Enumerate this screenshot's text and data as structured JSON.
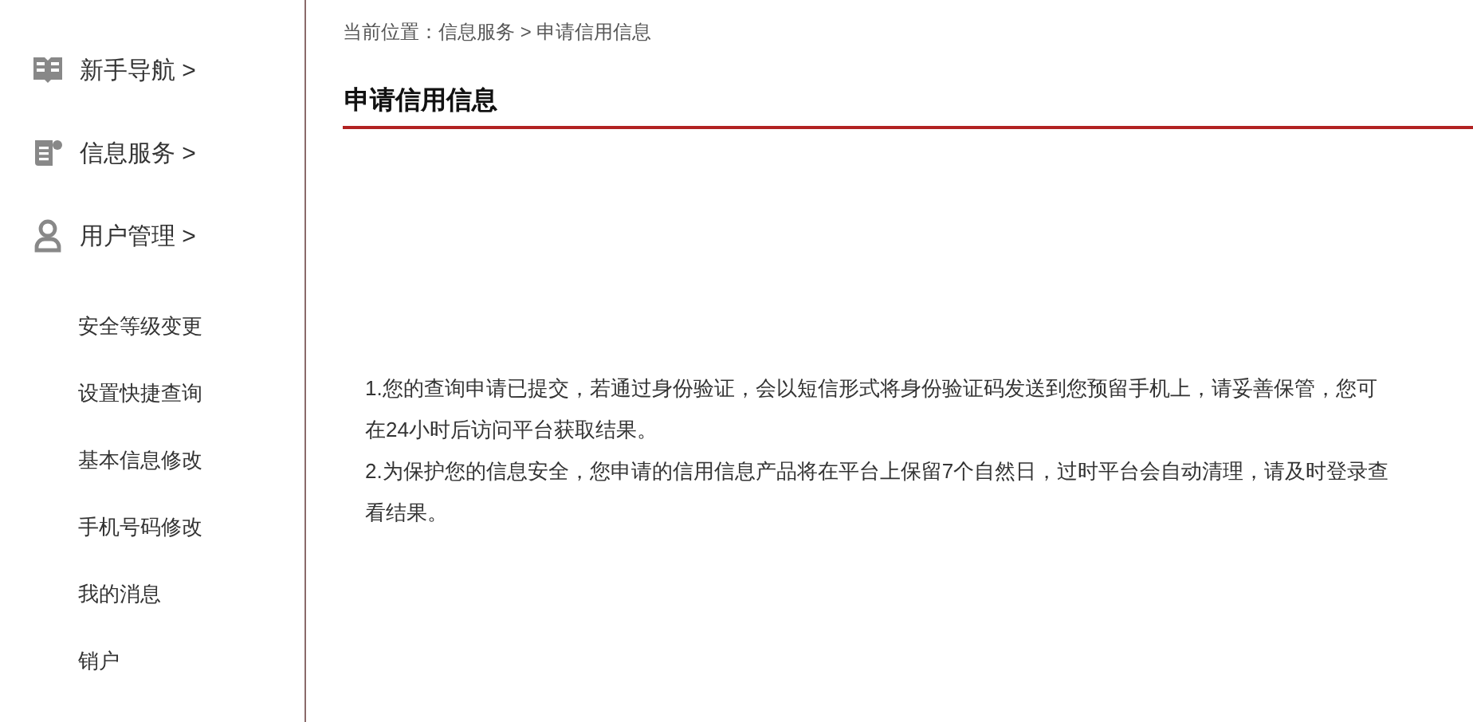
{
  "sidebar": {
    "sections": [
      {
        "kind": "book",
        "label": "新手导航 >"
      },
      {
        "kind": "document",
        "label": "信息服务 >"
      },
      {
        "kind": "user",
        "label": "用户管理 >"
      }
    ],
    "items": [
      "安全等级变更",
      "设置快捷查询",
      "基本信息修改",
      "手机号码修改",
      "我的消息",
      "销户"
    ]
  },
  "breadcrumb": "当前位置：信息服务 > 申请信用信息",
  "title": "申请信用信息",
  "notices": [
    "1.您的查询申请已提交，若通过身份验证，会以短信形式将身份验证码发送到您预留手机上，请妥善保管，您可在24小时后访问平台获取结果。",
    "2.为保护您的信息安全，您申请的信用信息产品将在平台上保留7个自然日，过时平台会自动清理，请及时登录查看结果。"
  ]
}
